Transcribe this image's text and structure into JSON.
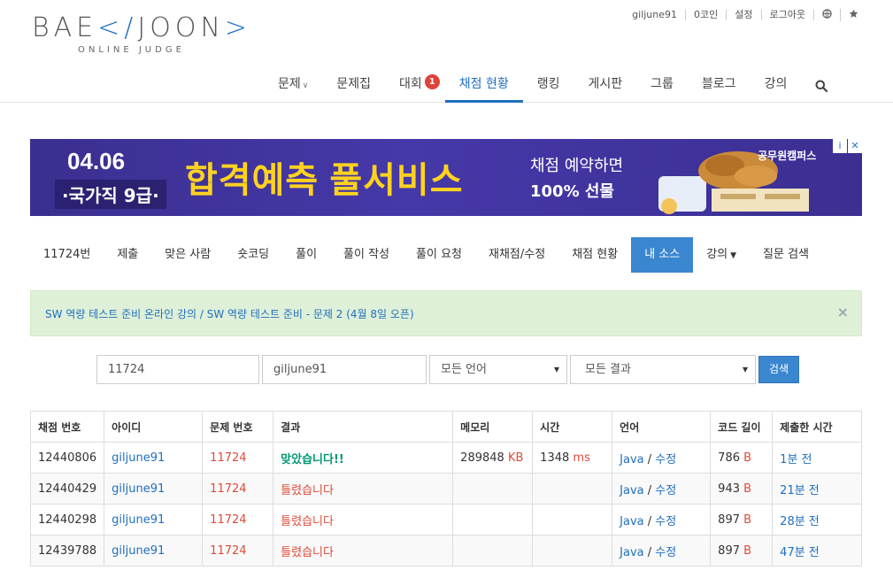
{
  "header": {
    "logo_text_a": "BAE",
    "logo_text_b": "JOON",
    "logo_sub": "ONLINE JUDGE",
    "top_links": [
      "giljune91",
      "0코인",
      "설정",
      "로그아웃"
    ],
    "nav": [
      {
        "label": "문제",
        "dropdown": true
      },
      {
        "label": "문제집"
      },
      {
        "label": "대회",
        "badge": "1"
      },
      {
        "label": "채점 현황",
        "active": true
      },
      {
        "label": "랭킹"
      },
      {
        "label": "게시판"
      },
      {
        "label": "그룹"
      },
      {
        "label": "블로그"
      },
      {
        "label": "강의"
      }
    ]
  },
  "banner": {
    "date": "04.06",
    "exam": "·국가직 9급·",
    "headline": "합격예측 풀서비스",
    "sub1": "채점 예약하면",
    "sub2": "100% 선물",
    "brand": "공무원캠퍼스"
  },
  "problem_menu": [
    {
      "label": "11724번"
    },
    {
      "label": "제출"
    },
    {
      "label": "맞은 사람"
    },
    {
      "label": "숏코딩"
    },
    {
      "label": "풀이"
    },
    {
      "label": "풀이 작성"
    },
    {
      "label": "풀이 요청"
    },
    {
      "label": "재채점/수정"
    },
    {
      "label": "채점 현황"
    },
    {
      "label": "내 소스",
      "active": true
    },
    {
      "label": "강의",
      "dropdown": true
    },
    {
      "label": "질문 검색"
    }
  ],
  "alert": {
    "part1": "SW 역량 테스트 준비 온라인 강의",
    "sep": " / ",
    "part2": "SW 역량 테스트 준비 - 문제 2 (4월 8일 오픈)",
    "close": "×"
  },
  "filter": {
    "problem_id": "11724",
    "user_id": "giljune91",
    "language": "모든 언어",
    "result": "모든 결과",
    "search_label": "검색"
  },
  "table": {
    "headers": [
      "채점 번호",
      "아이디",
      "문제 번호",
      "결과",
      "메모리",
      "시간",
      "언어",
      "코드 길이",
      "제출한 시간"
    ],
    "rows": [
      {
        "id": "12440806",
        "user": "giljune91",
        "problem": "11724",
        "result": "맞았습니다!!",
        "ok": true,
        "memory": "289848",
        "memory_unit": "KB",
        "time": "1348",
        "time_unit": "ms",
        "lang": "Java",
        "edit": "수정",
        "length": "786",
        "length_unit": "B",
        "submitted": "1분 전"
      },
      {
        "id": "12440429",
        "user": "giljune91",
        "problem": "11724",
        "result": "틀렸습니다",
        "ok": false,
        "memory": "",
        "memory_unit": "",
        "time": "",
        "time_unit": "",
        "lang": "Java",
        "edit": "수정",
        "length": "943",
        "length_unit": "B",
        "submitted": "21분 전"
      },
      {
        "id": "12440298",
        "user": "giljune91",
        "problem": "11724",
        "result": "틀렸습니다",
        "ok": false,
        "memory": "",
        "memory_unit": "",
        "time": "",
        "time_unit": "",
        "lang": "Java",
        "edit": "수정",
        "length": "897",
        "length_unit": "B",
        "submitted": "28분 전"
      },
      {
        "id": "12439788",
        "user": "giljune91",
        "problem": "11724",
        "result": "틀렸습니다",
        "ok": false,
        "memory": "",
        "memory_unit": "",
        "time": "",
        "time_unit": "",
        "lang": "Java",
        "edit": "수정",
        "length": "897",
        "length_unit": "B",
        "submitted": "47분 전"
      }
    ]
  }
}
